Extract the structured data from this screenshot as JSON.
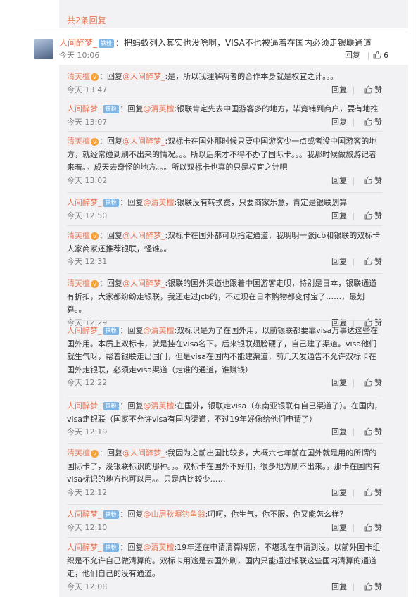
{
  "top": {
    "total_replies": "共2条回复"
  },
  "main_comment": {
    "author": "人间醉梦_",
    "badge": "铁粉",
    "text": "：把蚂蚁列入其实也没啥啊，VISA不也被逼着在国内必须走银联通道",
    "time": "今天 10:06",
    "reply_label": "回复",
    "like_count": "6"
  },
  "replies": [
    {
      "author": "清芙檀",
      "vip": true,
      "prefix": "：回复",
      "mention": "@人间醉梦_",
      "text": ":是，所以我理解两者的合作本身就是权宜之计。。。",
      "time": "今天 13:47",
      "reply_label": "回复",
      "like_label": "赞"
    },
    {
      "author": "人间醉梦_",
      "badge": "铁粉",
      "prefix": "：回复",
      "mention": "@清芙檀",
      "text": ":银联肯定先去中国游客多的地方，毕竟铺到商户，要有地推",
      "time": "今天 13:07",
      "reply_label": "回复",
      "like_label": "赞"
    },
    {
      "author": "清芙檀",
      "vip": true,
      "prefix": "：回复",
      "mention": "@人间醉梦_",
      "text": ":双标卡在国外那时候只要中国游客少一点或者没中国游客的地方，就经常碰到刷不出来的情况。。。所以后来才不得不办了国际卡。。。我那时候做旅游记者来着。。成天去奇怪的地方。。。所以双标卡也真的只是权宜之计吧",
      "time": "今天 13:02",
      "reply_label": "回复",
      "like_label": "赞"
    },
    {
      "author": "人间醉梦_",
      "badge": "铁粉",
      "prefix": "：回复",
      "mention": "@清芙檀",
      "text": ":银联没有转换费，只要商家乐意，肯定是银联划算",
      "time": "今天 12:50",
      "reply_label": "回复",
      "like_label": "赞"
    },
    {
      "author": "清芙檀",
      "vip": true,
      "prefix": "：回复",
      "mention": "@人间醉梦_",
      "text": ":双标卡在国外都可以指定通道，我明明一张jcb和银联的双标卡人家商家还推荐银联，怪谁。。",
      "time": "今天 12:31",
      "reply_label": "回复",
      "like_label": "赞"
    },
    {
      "author": "清芙檀",
      "vip": true,
      "prefix": "：回复",
      "mention": "@人间醉梦_",
      "text": ":银联的国外渠道也跟着中国游客走呗，特别是日本，银联通道有折扣，大家都纷纷走银联，我还走过jcb的，不过现在日本购物都变付宝了……，最划算。。",
      "time": "今天 12:29",
      "reply_label": "回复",
      "like_label": "赞"
    },
    {
      "author": "人间醉梦_",
      "badge": "铁粉",
      "prefix": "：回复",
      "mention": "@清芙檀",
      "text": ":双标识是为了在国外用，以前银联都要靠visa万事达这些在国外用。本质上双标卡，就是挂在visa名下。后来银联翅膀硬了，自己建了渠道。visa他们就生气呀，帮着银联走出国门，但是visa在国内不能建渠道，前几天发通告不允许双标卡在国外走银联，必须走visa渠道（走谁的通道，谁赚钱）",
      "time": "今天 12:22",
      "reply_label": "回复",
      "like_label": "赞"
    },
    {
      "author": "人间醉梦_",
      "badge": "铁粉",
      "prefix": "：回复",
      "mention": "@清芙檀",
      "text": ":在国外，银联走visa（东南亚银联有自己渠道了）。在国内，visa走银联（国家不允许visa有国内渠道，不过19年好像给他们申请了）",
      "time": "今天 12:19",
      "reply_label": "回复",
      "like_label": "赞"
    },
    {
      "author": "清芙檀",
      "vip": true,
      "prefix": "：回复",
      "mention": "@人间醉梦_",
      "text": ":我因为之前出国比较多，大概六七年前在国外就是用的所谓的国际卡了，没银联标识的那种。。。双标卡在国外不好用，很多地方刷不出来。。那卡在国内有visa标识的地方也可以用。。只是店比较少……",
      "time": "今天 12:12",
      "reply_label": "回复",
      "like_label": "赞"
    },
    {
      "author": "人间醉梦_",
      "badge": "铁粉",
      "prefix": "：回复",
      "mention": "@山居秋暝钓鱼翁",
      "text": ":呵呵，你生气，你不服，你又能怎么样？",
      "time": "今天 12:10",
      "reply_label": "回复",
      "like_label": "赞"
    },
    {
      "author": "人间醉梦_",
      "badge": "铁粉",
      "prefix": "：回复",
      "mention": "@清芙檀",
      "text": ":19年还在申请清算牌照，不堪现在申请到没。以前外国卡组织是不允许自己做清算的。双标卡用途是去国外刷，国内只能通过银联这些国内清算的通道走，他们自己的没有通道。",
      "time": "今天 12:08",
      "reply_label": "回复",
      "like_label": "赞"
    }
  ]
}
